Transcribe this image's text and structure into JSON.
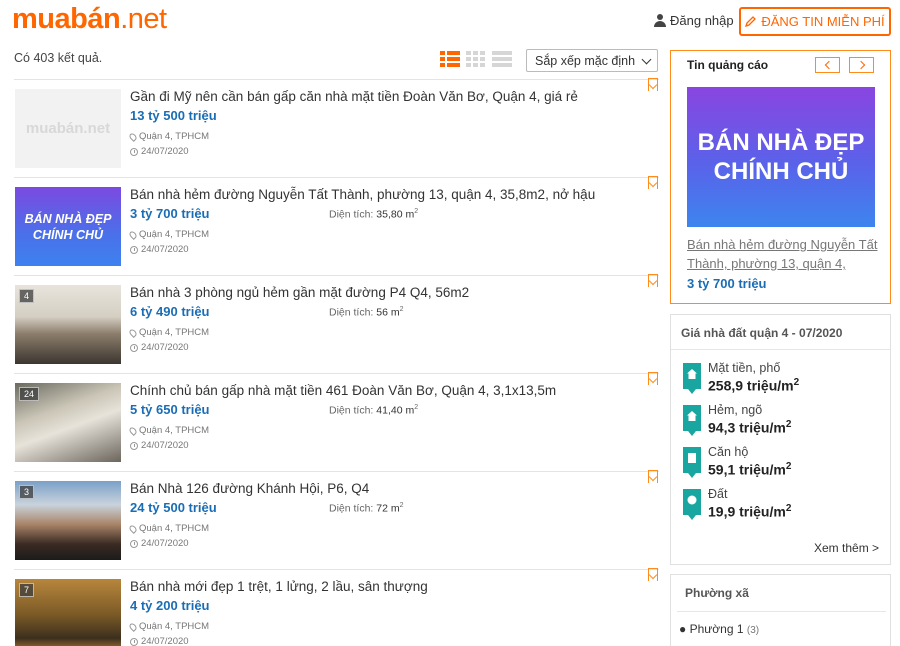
{
  "header": {
    "logo_brand": "muabán",
    "logo_tld": ".net",
    "login_label": "Đăng nhập",
    "post_label": "ĐĂNG TIN MIỄN PHÍ"
  },
  "toolbar": {
    "result_count": "Có 403 kết quả.",
    "sort_value": "Sắp xếp mặc định"
  },
  "listings": [
    {
      "title": "Gần đi Mỹ nên cần bán gấp căn nhà mặt tiền Đoàn Văn Bơ, Quận 4, giá rẻ",
      "price": "13 tỷ 500 triệu",
      "area_label": "",
      "area_value": "",
      "location": "Quận 4, TPHCM",
      "date": "24/07/2020",
      "photo_count": "",
      "thumb_text": "muabán.net"
    },
    {
      "title": "Bán nhà hẻm đường Nguyễn Tất Thành, phường 13, quận 4, 35,8m2, nở hậu",
      "price": "3 tỷ 700 triệu",
      "area_label": "Diện tích:",
      "area_value": "35,80 m",
      "location": "Quận 4, TPHCM",
      "date": "24/07/2020",
      "photo_count": "",
      "thumb_text": "BÁN NHÀ ĐẸP CHÍNH CHỦ"
    },
    {
      "title": "Bán nhà 3 phòng ngủ hẻm gần mặt đường P4 Q4, 56m2",
      "price": "6 tỷ 490 triệu",
      "area_label": "Diện tích:",
      "area_value": "56 m",
      "location": "Quận 4, TPHCM",
      "date": "24/07/2020",
      "photo_count": "4",
      "thumb_text": ""
    },
    {
      "title": "Chính chủ bán gấp nhà mặt tiền 461 Đoàn Văn Bơ, Quận 4, 3,1x13,5m",
      "price": "5 tỷ 650 triệu",
      "area_label": "Diện tích:",
      "area_value": "41,40 m",
      "location": "Quận 4, TPHCM",
      "date": "24/07/2020",
      "photo_count": "24",
      "thumb_text": ""
    },
    {
      "title": "Bán Nhà 126 đường Khánh Hội, P6, Q4",
      "price": "24 tỷ 500 triệu",
      "area_label": "Diện tích:",
      "area_value": "72 m",
      "location": "Quận 4, TPHCM",
      "date": "24/07/2020",
      "photo_count": "3",
      "thumb_text": ""
    },
    {
      "title": "Bán nhà mới đẹp 1 trệt, 1 lửng, 2 lầu, sân thượng",
      "price": "4 tỷ 200 triệu",
      "area_label": "",
      "area_value": "",
      "location": "Quận 4, TPHCM",
      "date": "24/07/2020",
      "photo_count": "7",
      "thumb_text": ""
    }
  ],
  "area_sup": "2",
  "sidebar_ad": {
    "title": "Tin quảng cáo",
    "banner_text": "BÁN NHÀ ĐẸP CHÍNH CHỦ",
    "link_text": "Bán nhà hẻm đường Nguyễn Tất Thành, phường 13, quận 4,",
    "price": "3 tỷ 700 triệu"
  },
  "price_box": {
    "title": "Giá nhà đất quận 4 - 07/2020",
    "items": [
      {
        "label": "Mặt tiền, phố",
        "value": "258,9 triệu/m",
        "sup": "2"
      },
      {
        "label": "Hẻm, ngõ",
        "value": "94,3 triệu/m",
        "sup": "2"
      },
      {
        "label": "Căn hộ",
        "value": "59,1 triệu/m",
        "sup": "2"
      },
      {
        "label": "Đất",
        "value": "19,9 triệu/m",
        "sup": "2"
      }
    ],
    "more_label": "Xem thêm >"
  },
  "ward_box": {
    "title": "Phường xã",
    "items": [
      {
        "label": "● Phường 1",
        "count": "(3)"
      }
    ]
  },
  "colors": {
    "accent": "#ff6600",
    "price_blue": "#1a6db5",
    "teal": "#1aa6a0"
  }
}
